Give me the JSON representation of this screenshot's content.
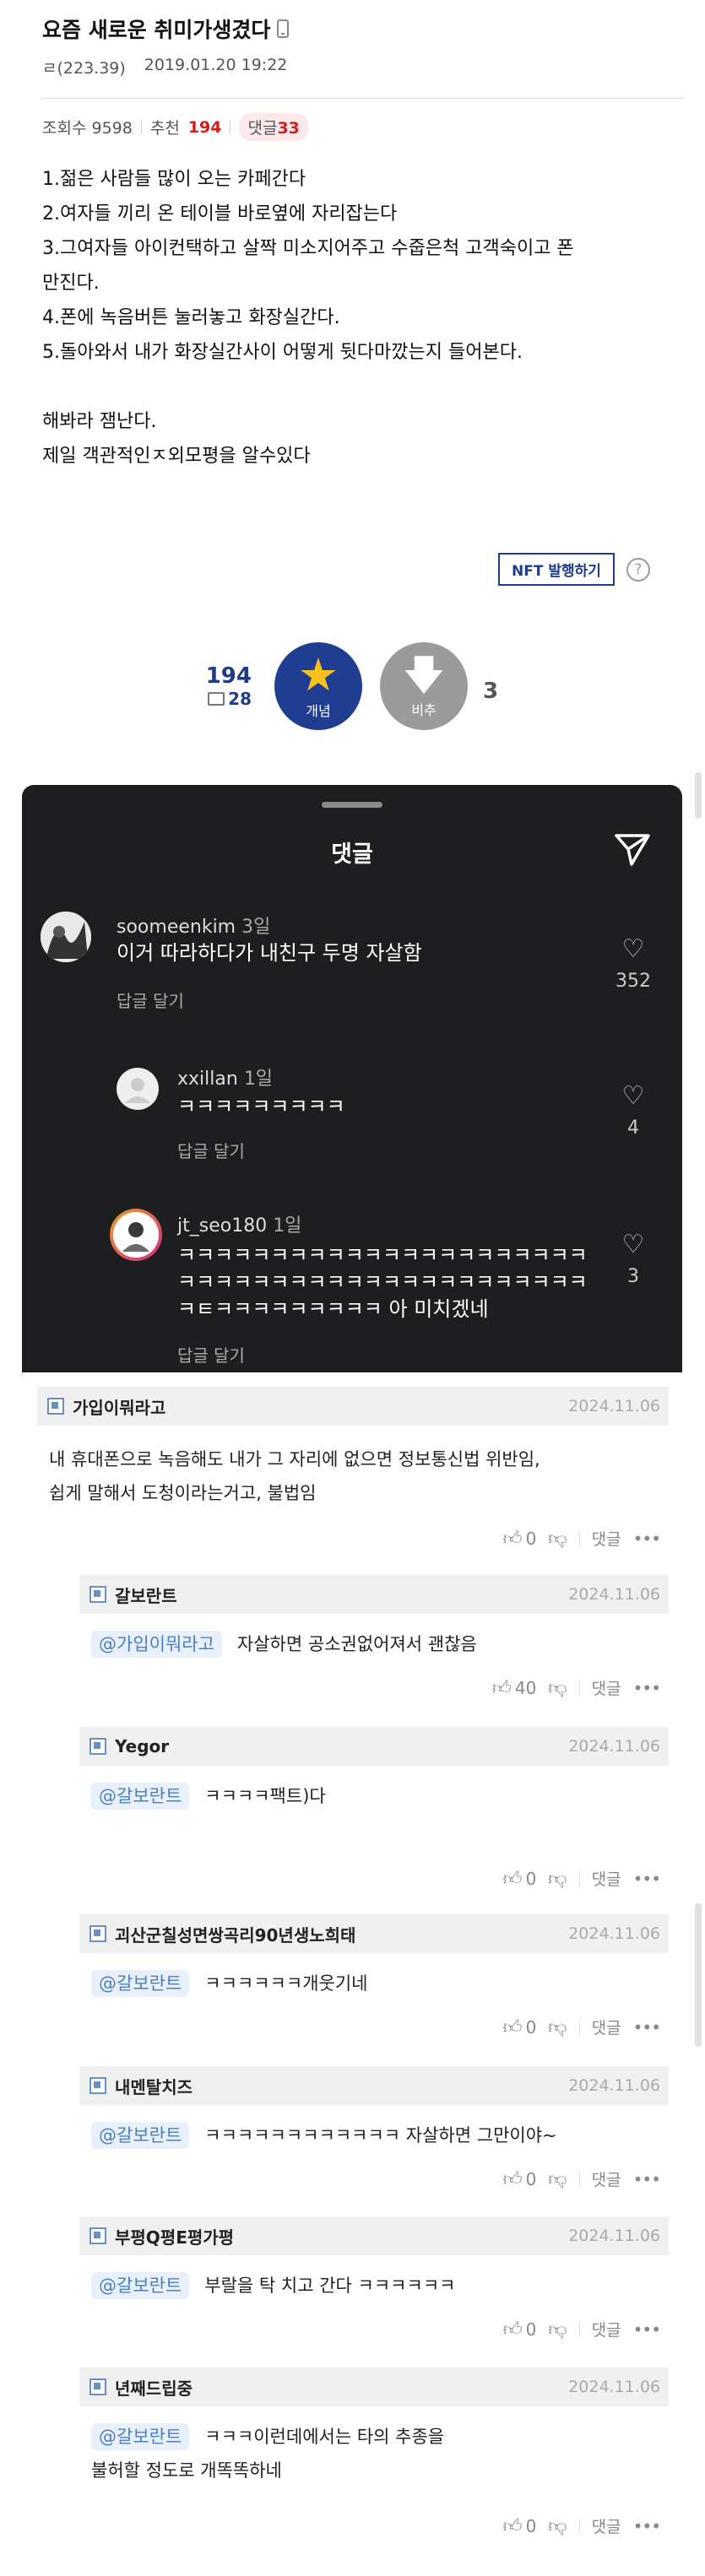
{
  "post": {
    "title": "요즘 새로운 취미가생겼다",
    "author": "ㄹ(223.39)",
    "datetime": "2019.01.20 19:22",
    "views_label": "조회수 9598",
    "recommend_label": "추천",
    "recommend_count": "194",
    "comments_label": "댓글",
    "comments_count": "33",
    "body_lines": [
      "1.젊은 사람들 많이 오는 카페간다",
      "2.여자들 끼리 온 테이블 바로옆에 자리잡는다",
      "3.그여자들 아이컨택하고 살짝 미소지어주고 수줍은척 고객숙이고 폰",
      "만진다.",
      "4.폰에 녹음버튼 눌러놓고 화장실간다.",
      "5.돌아와서 내가 화장실간사이 어떻게 뒷다마깠는지 들어본다.",
      "해봐라 잼난다.",
      "제일 객관적인ㅈ외모평을 알수있다"
    ],
    "nft_button": "NFT 발행하기",
    "help": "?"
  },
  "vote": {
    "up_count": "194",
    "up_sub": "28",
    "up_label": "개념",
    "down_label": "비추",
    "down_count": "3"
  },
  "embedded": {
    "title": "댓글",
    "comments": [
      {
        "user": "soomeenkim",
        "ago": "3일",
        "text": [
          "이거 따라하다가 내친구 두명 자살함"
        ],
        "reply": "답글 달기",
        "likes": "352"
      },
      {
        "user": "xxillan",
        "ago": "1일",
        "text": [
          "ㅋㅋㅋㅋㅋㅋㅋㅋㅋ"
        ],
        "reply": "답글 달기",
        "likes": "4"
      },
      {
        "user": "jt_seo180",
        "ago": "1일",
        "text": [
          "ㅋㅋㅋㅋㅋㅋㅋㅋㅋㅋㅋㅋㅋㅋㅋㅋㅋㅋㅋㅋㅋㅋ",
          "ㅋㅋㅋㅋㅋㅋㅋㅋㅋㅋㅋㅋㅋㅋㅋㅋㅋㅋㅋㅋㅋㅋ",
          "ㅋㅌㅋㅋㅋㅋㅋㅋㅋㅋㅋ 아 미치겠네"
        ],
        "reply": "답글 달기",
        "likes": "3"
      }
    ]
  },
  "comments": [
    {
      "nick": "가입이뭐라고",
      "date": "2024.11.06",
      "mention": "",
      "text": [
        "내 휴대폰으로 녹음해도 내가 그 자리에 없으면 정보통신법 위반임,",
        "쉽게 말해서 도청이라는거고, 불법임"
      ],
      "likes": "0",
      "reply": "댓글",
      "more": "•••"
    },
    {
      "nick": "갈보란트",
      "date": "2024.11.06",
      "mention": "@가입이뭐라고",
      "text": [
        "자살하면 공소권없어져서 괜찮음"
      ],
      "likes": "40",
      "reply": "댓글",
      "more": "•••"
    },
    {
      "nick": "Yegor",
      "date": "2024.11.06",
      "mention": "@갈보란트",
      "text": [
        "ㅋㅋㅋㅋ팩트)다"
      ],
      "likes": "0",
      "reply": "댓글",
      "more": "•••"
    },
    {
      "nick": "괴산군칠성면쌍곡리90년생노희태",
      "date": "2024.11.06",
      "mention": "@갈보란트",
      "text": [
        "ㅋㅋㅋㅋㅋㅋ개웃기네"
      ],
      "likes": "0",
      "reply": "댓글",
      "more": "•••"
    },
    {
      "nick": "내멘탈치즈",
      "date": "2024.11.06",
      "mention": "@갈보란트",
      "text": [
        "ㅋㅋㅋㅋㅋㅋㅋㅋㅋㅋㅋㅋ 자살하면 그만이야~"
      ],
      "likes": "0",
      "reply": "댓글",
      "more": "•••"
    },
    {
      "nick": "부평Q평E평가평",
      "date": "2024.11.06",
      "mention": "@갈보란트",
      "text": [
        "부랄을 탁 치고 간다 ㅋㅋㅋㅋㅋㅋ"
      ],
      "likes": "0",
      "reply": "댓글",
      "more": "•••"
    },
    {
      "nick": "년째드립중",
      "date": "2024.11.06",
      "mention": "@갈보란트",
      "text": [
        "ㅋㅋㅋ이런데에서는 타의 추종을",
        "불허할 정도로 개똑똑하네"
      ],
      "likes": "0",
      "reply": "댓글",
      "more": "•••"
    }
  ],
  "colors": {
    "accent": "#1f3e91",
    "recommend": "#d21e1e",
    "mention": "#4a7ec4",
    "dark_bg": "#1e1e21"
  }
}
